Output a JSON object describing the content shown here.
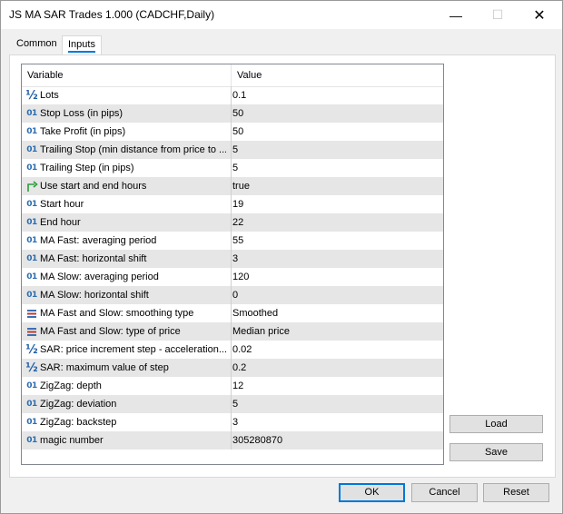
{
  "window": {
    "title": "JS MA SAR Trades 1.000 (CADCHF,Daily)",
    "minimize_glyph": "—",
    "maximize_glyph": "☐",
    "close_glyph": "✕"
  },
  "tabs": [
    {
      "label": "Common",
      "active": false
    },
    {
      "label": "Inputs",
      "active": true
    }
  ],
  "grid": {
    "headers": {
      "variable": "Variable",
      "value": "Value"
    },
    "rows": [
      {
        "icon": "fraction-icon",
        "name": "Lots",
        "value": "0.1"
      },
      {
        "icon": "integer-icon",
        "name": "Stop Loss (in pips)",
        "value": "50"
      },
      {
        "icon": "integer-icon",
        "name": "Take Profit (in pips)",
        "value": "50"
      },
      {
        "icon": "integer-icon",
        "name": "Trailing Stop (min distance from price to ...",
        "value": "5"
      },
      {
        "icon": "integer-icon",
        "name": "Trailing Step (in pips)",
        "value": "5"
      },
      {
        "icon": "bool-arrow-icon",
        "name": "Use start and end hours",
        "value": "true"
      },
      {
        "icon": "integer-icon",
        "name": "Start hour",
        "value": "19"
      },
      {
        "icon": "integer-icon",
        "name": "End hour",
        "value": "22"
      },
      {
        "icon": "integer-icon",
        "name": "MA Fast: averaging period",
        "value": "55"
      },
      {
        "icon": "integer-icon",
        "name": "MA Fast: horizontal shift",
        "value": "3"
      },
      {
        "icon": "integer-icon",
        "name": "MA Slow: averaging period",
        "value": "120"
      },
      {
        "icon": "integer-icon",
        "name": "MA Slow: horizontal shift",
        "value": "0"
      },
      {
        "icon": "enum-icon",
        "name": "MA Fast and Slow: smoothing type",
        "value": "Smoothed"
      },
      {
        "icon": "enum-icon",
        "name": "MA Fast and Slow: type of price",
        "value": "Median price"
      },
      {
        "icon": "fraction-icon",
        "name": "SAR: price increment step - acceleration...",
        "value": "0.02"
      },
      {
        "icon": "fraction-icon",
        "name": "SAR: maximum value of step",
        "value": "0.2"
      },
      {
        "icon": "integer-icon",
        "name": "ZigZag: depth",
        "value": "12"
      },
      {
        "icon": "integer-icon",
        "name": "ZigZag: deviation",
        "value": "5"
      },
      {
        "icon": "integer-icon",
        "name": "ZigZag: backstep",
        "value": "3"
      },
      {
        "icon": "integer-icon",
        "name": "magic number",
        "value": "305280870"
      }
    ]
  },
  "buttons": {
    "load": "Load",
    "save": "Save",
    "ok": "OK",
    "cancel": "Cancel",
    "reset": "Reset"
  },
  "colors": {
    "accent": "#0078d7",
    "row_alt": "#e6e6e6",
    "int_icon": "#2b6cb0",
    "bool_icon": "#2a9d3a",
    "enum_icon": "#3a6fb5"
  }
}
